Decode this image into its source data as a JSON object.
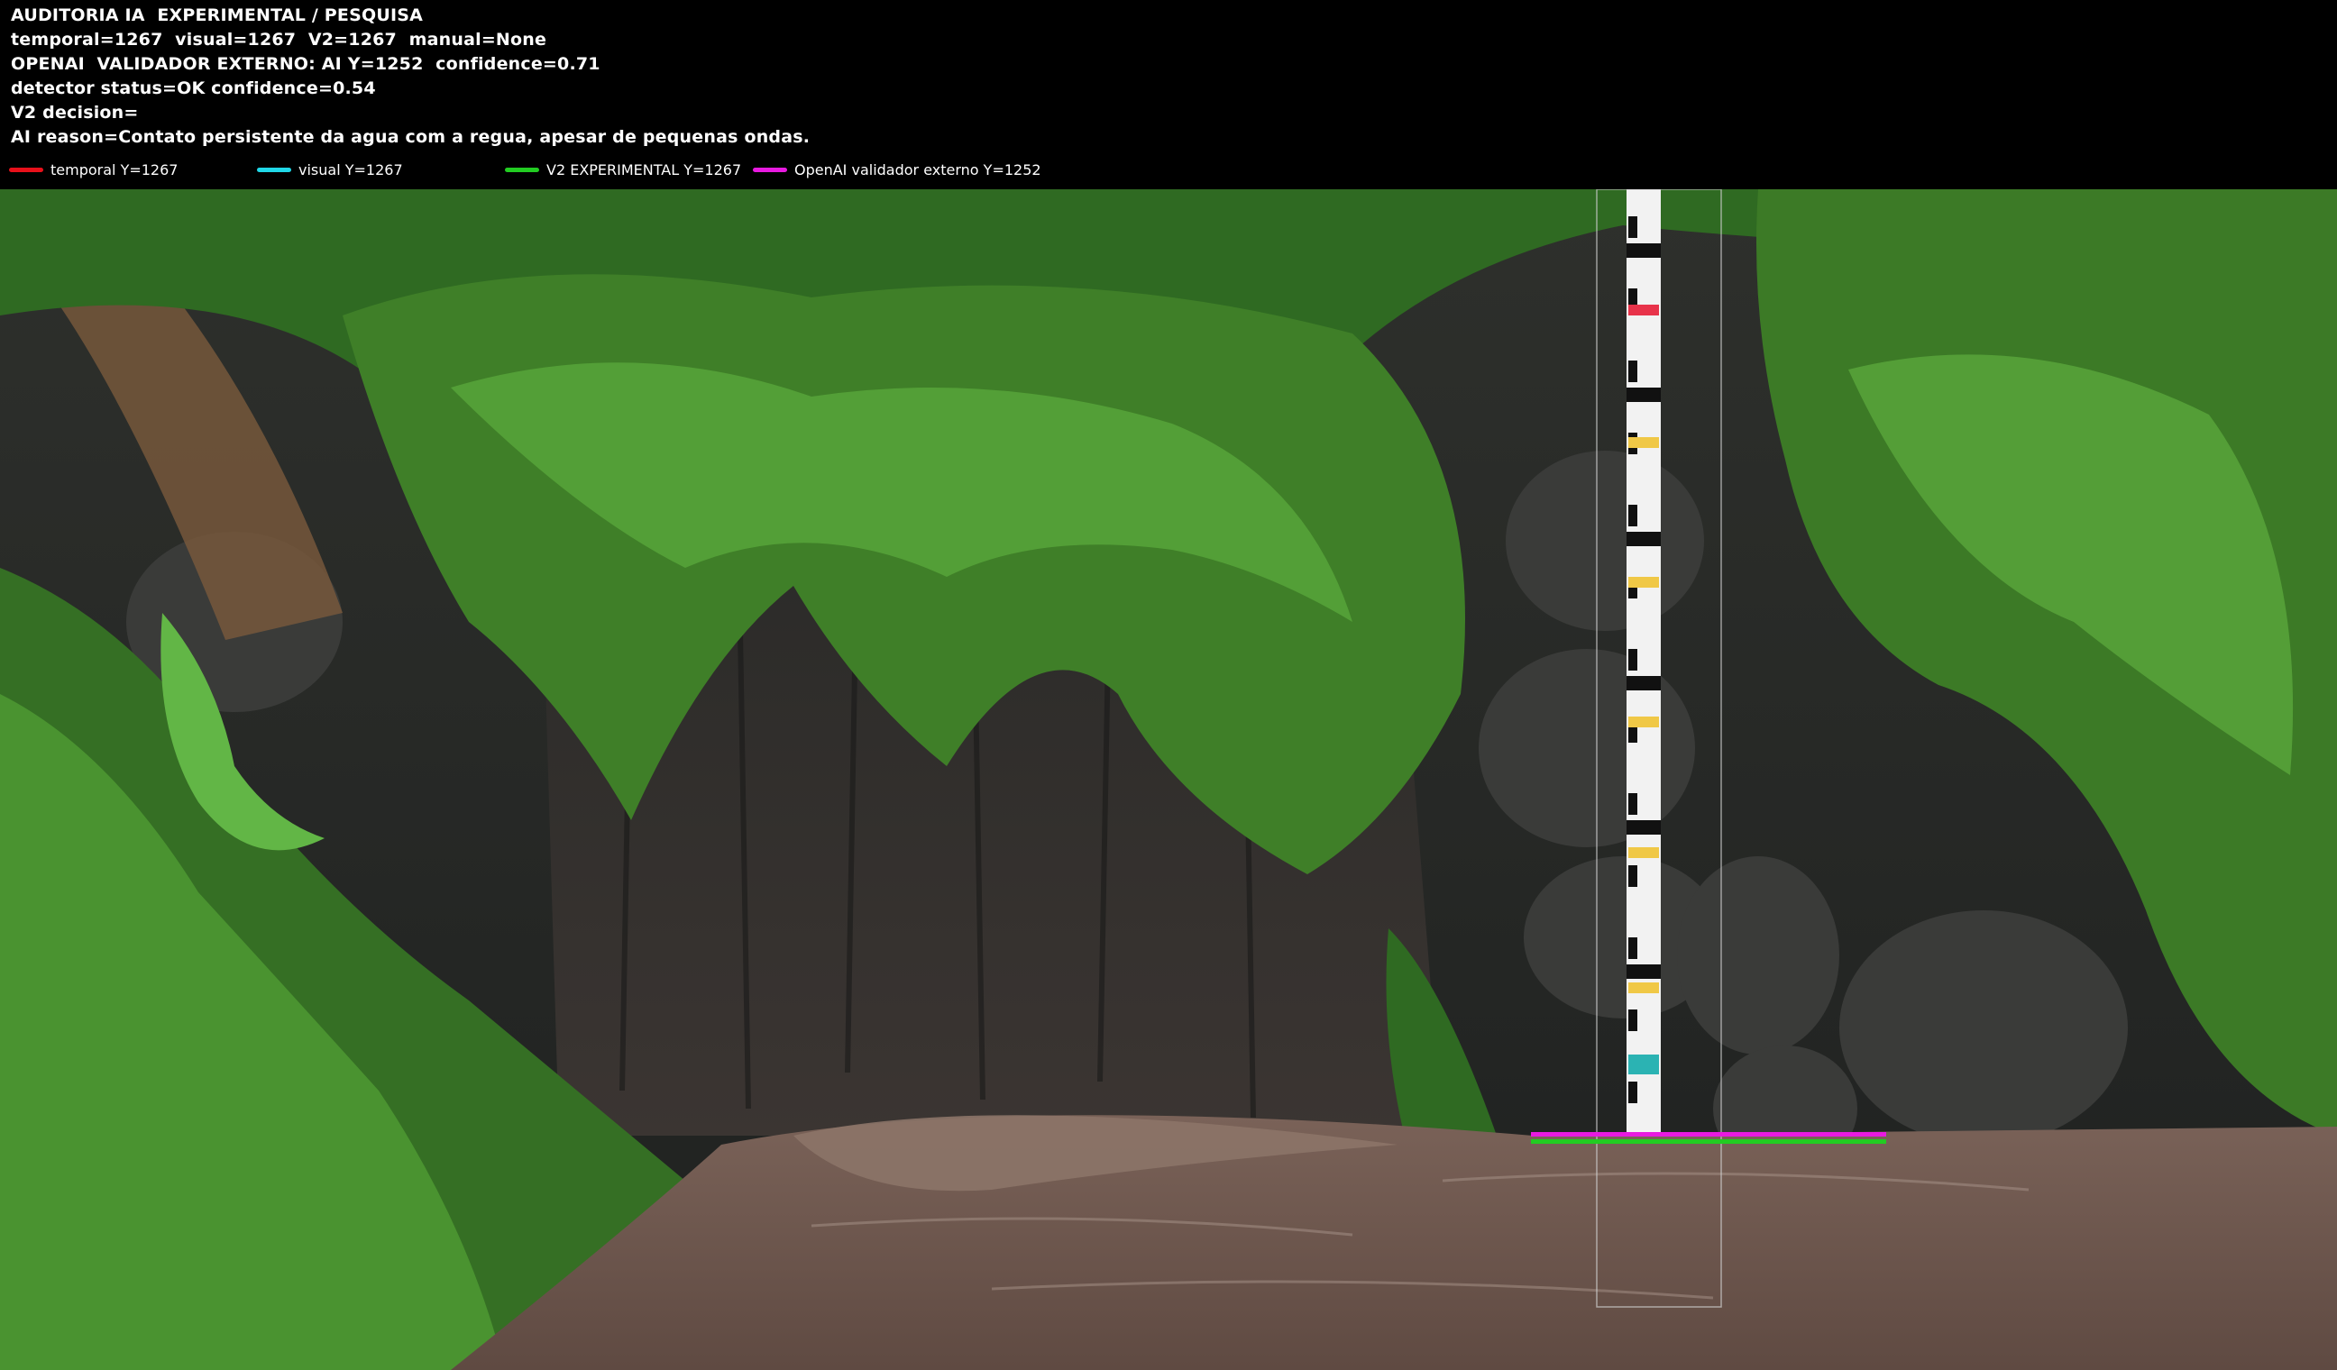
{
  "hud": {
    "title": "AUDITORIA IA  EXPERIMENTAL / PESQUISA",
    "line_values": "temporal=1267  visual=1267  V2=1267  manual=None",
    "line_openai": "OPENAI  VALIDADOR EXTERNO: AI Y=1252  confidence=0.71",
    "line_detector": "detector status=OK confidence=0.54",
    "line_decision": "V2 decision=",
    "line_reason": "AI reason=Contato persistente da agua com a regua, apesar de pequenas ondas."
  },
  "legend": [
    {
      "label": "temporal Y=1267",
      "color": "#e8101a"
    },
    {
      "label": "visual Y=1267",
      "color": "#20d8e8"
    },
    {
      "label": "V2 EXPERIMENTAL Y=1267",
      "color": "#22cc22"
    },
    {
      "label": "OpenAI validador externo Y=1252",
      "color": "#e81ae0"
    }
  ],
  "colors": {
    "water": "#6e5a50",
    "rock": "#3c3c3a",
    "foliage": "#3f7f28",
    "gauge_white": "#f2f2f2",
    "gauge_black": "#111111"
  },
  "icons": [
    "staff-gauge",
    "water-line-marker"
  ]
}
